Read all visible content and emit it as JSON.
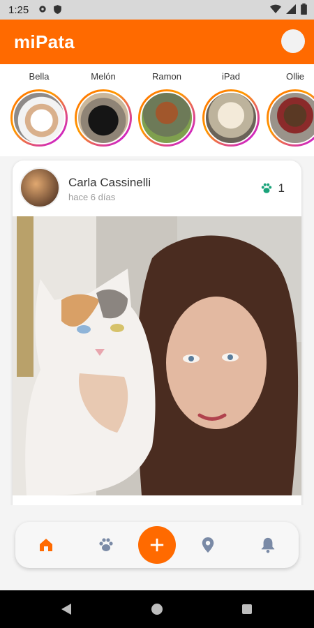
{
  "status_bar": {
    "time": "1:25",
    "icons": [
      "gear-icon",
      "shield-icon",
      "wifi-icon",
      "signal-icon",
      "battery-icon"
    ]
  },
  "app_bar": {
    "title": "miPata",
    "avatar": "profile-avatar"
  },
  "stories": [
    {
      "name": "Bella"
    },
    {
      "name": "Melón"
    },
    {
      "name": "Ramon"
    },
    {
      "name": "iPad"
    },
    {
      "name": "Ollie"
    }
  ],
  "post": {
    "author": "Carla Cassinelli",
    "time": "hace 6 días",
    "likes": "1",
    "like_icon": "paw-icon"
  },
  "bottom_nav": {
    "items": [
      "home-icon",
      "paw-icon",
      "add-icon",
      "location-icon",
      "bell-icon"
    ],
    "active": "home-icon"
  },
  "colors": {
    "brand": "#ff6a00",
    "like": "#1aa37a",
    "inactive_icon": "#7a8aa6"
  },
  "system_nav": [
    "back-icon",
    "home-circle-icon",
    "recents-icon"
  ]
}
